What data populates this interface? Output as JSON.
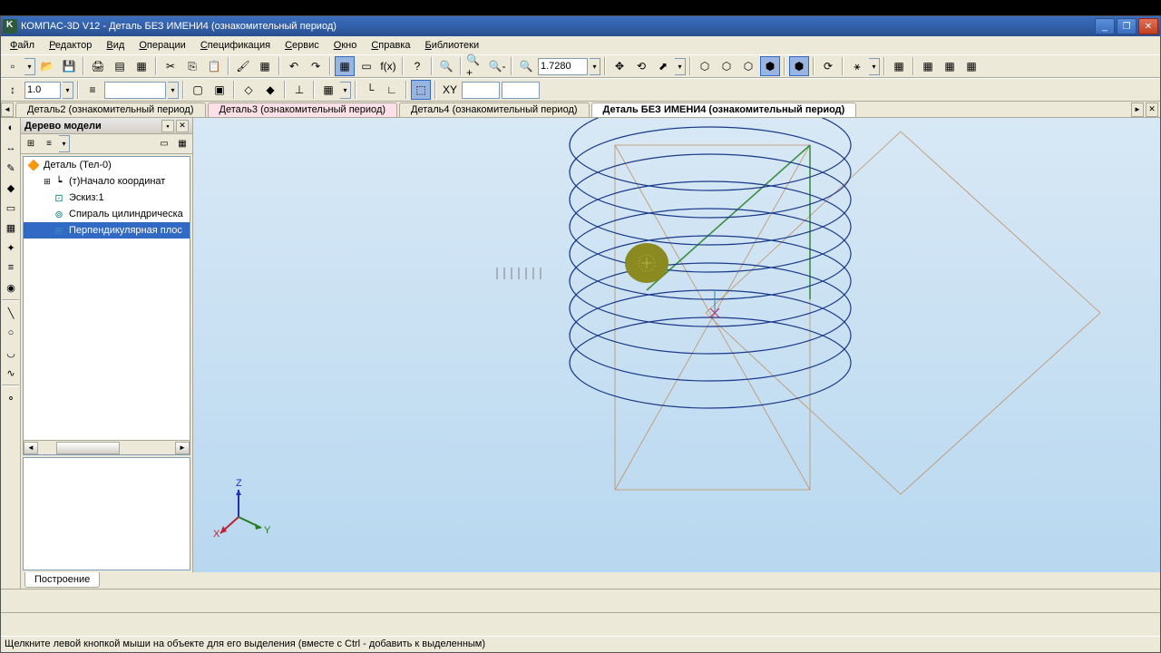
{
  "title": "КОМПАС-3D V12 - Деталь БЕЗ ИМЕНИ4 (ознакомительный период)",
  "menu": {
    "file": "Файл",
    "edit": "Редактор",
    "view": "Вид",
    "operations": "Операции",
    "spec": "Спецификация",
    "service": "Сервис",
    "window": "Окно",
    "help": "Справка",
    "libs": "Библиотеки"
  },
  "toolbar": {
    "line_width": "1.0",
    "zoom_value": "1.7280"
  },
  "tabs": [
    {
      "label": "Деталь2 (ознакомительный период)",
      "class": ""
    },
    {
      "label": "Деталь3 (ознакомительный период)",
      "class": "pink"
    },
    {
      "label": "Деталь4 (ознакомительный период)",
      "class": ""
    },
    {
      "label": "Деталь БЕЗ ИМЕНИ4 (ознакомительный период)",
      "class": "active"
    }
  ],
  "tree": {
    "title": "Дерево модели",
    "root": "Деталь (Тел-0)",
    "items": [
      {
        "label": "(т)Начало координат"
      },
      {
        "label": "Эскиз:1"
      },
      {
        "label": "Спираль цилиндрическа"
      },
      {
        "label": "Перпендикулярная плос"
      }
    ]
  },
  "bottom_tab": "Построение",
  "status": "Щелкните левой кнопкой мыши на объекте для его выделения (вместе с Ctrl - добавить к выделенным)",
  "axes": {
    "x": "X",
    "y": "Y",
    "z": "Z"
  }
}
